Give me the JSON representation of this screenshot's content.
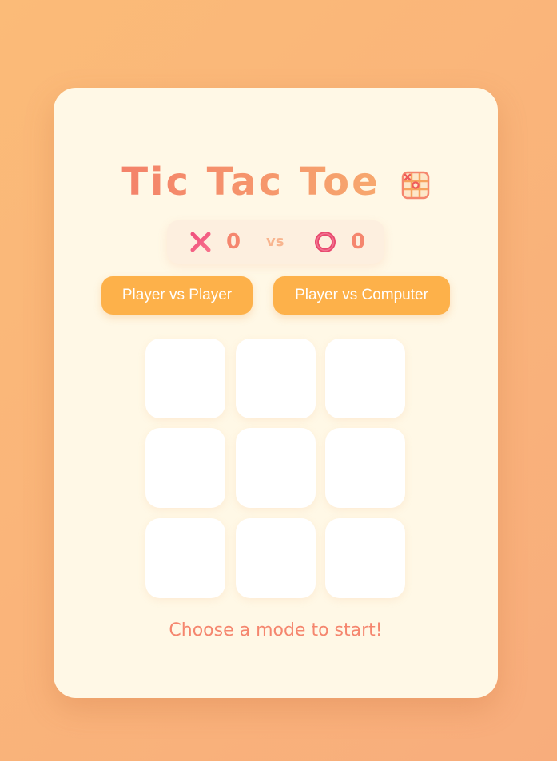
{
  "title": "Tic Tac Toe",
  "title_icon": "tic-tac-toe-grid-icon",
  "scoreboard": {
    "x_icon": "x-mark-icon",
    "x_score": "0",
    "vs_label": "vs",
    "o_icon": "o-ring-icon",
    "o_score": "0"
  },
  "modes": {
    "pvp_label": "Player vs Player",
    "pvc_label": "Player vs Computer"
  },
  "board": {
    "cells": [
      "",
      "",
      "",
      "",
      "",
      "",
      "",
      "",
      ""
    ]
  },
  "status": "Choose a mode to start!",
  "colors": {
    "background": "#fbbb78",
    "card": "#fff8e6",
    "accent": "#f5866e",
    "button": "#fdb14a",
    "x_mark": "#f0507e",
    "o_mark": "#e8486e"
  }
}
